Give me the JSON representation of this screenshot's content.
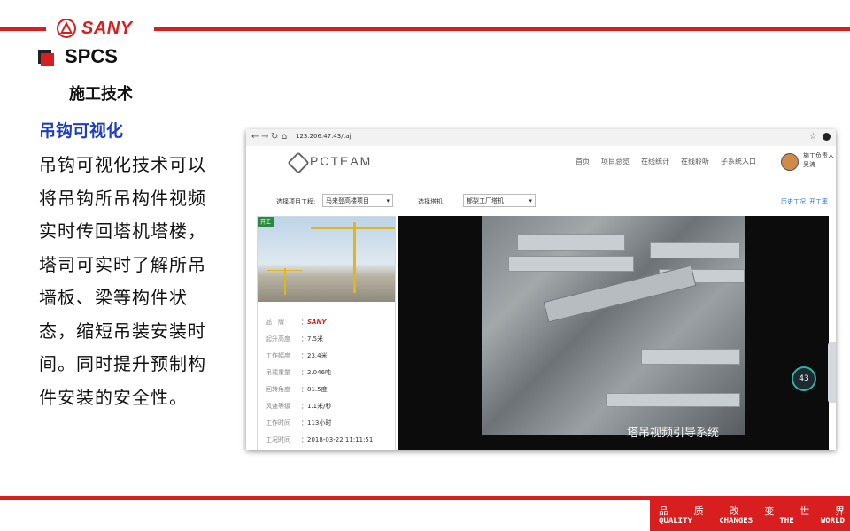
{
  "slide": {
    "logo": "SANY",
    "title": "SPCS",
    "subtitle": "施工技术",
    "section_title": "吊钩可视化",
    "body": "吊钩可视化技术可以将吊钩所吊构件视频实时传回塔机塔楼，塔司可实时了解所吊墙板、梁等构件状态，缩短吊装安装时间。同时提升预制构件安装的安全性。",
    "slogan_cn": [
      "品",
      "质",
      "改",
      "变",
      "世",
      "界"
    ],
    "slogan_en": [
      "QUALITY",
      "CHANGES",
      "THE",
      "WORLD"
    ],
    "colors": {
      "brand_red": "#d81e1e",
      "section_blue": "#1f3fbf"
    }
  },
  "browser": {
    "url": "123.206.47.43/taji",
    "app_name": "PCTEAM",
    "nav": [
      "首页",
      "项目总览",
      "在线统计",
      "在线聆听",
      "子系统入口"
    ],
    "user_role": "施工负责人",
    "user_name": "吴涛",
    "filters": {
      "project_label": "选择项目工程:",
      "project_value": "马来登高楼项目",
      "crane_label": "选择塔机:",
      "crane_value": "郁梨工厂塔机"
    },
    "links": {
      "history": "历史工况",
      "open": "开工率"
    },
    "crane_card": {
      "status": "开工",
      "rows": [
        {
          "label": "品　牌",
          "value": "SANY"
        },
        {
          "label": "起升高度",
          "value": "7.5米"
        },
        {
          "label": "工作幅度",
          "value": "23.4米"
        },
        {
          "label": "吊载重量",
          "value": "2.046吨"
        },
        {
          "label": "回转角度",
          "value": "81.5度"
        },
        {
          "label": "风速等级",
          "value": "1.1米/秒"
        },
        {
          "label": "工作时间",
          "value": "113小时"
        },
        {
          "label": "工况时间",
          "value": "2018-03-22 11:11:51"
        }
      ]
    },
    "video": {
      "caption": "塔吊视频引导系统",
      "gauge": "43"
    }
  }
}
